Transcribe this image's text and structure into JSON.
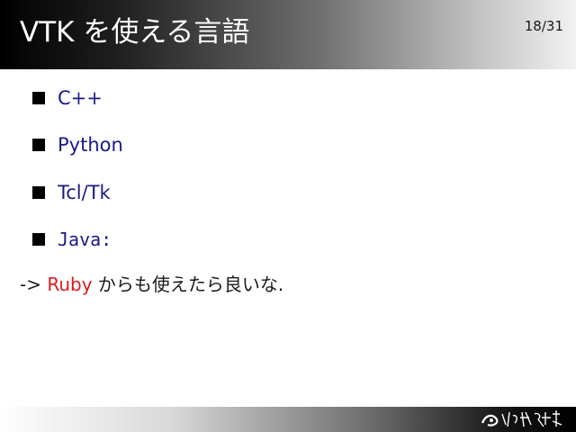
{
  "slide": {
    "title": "VTK を使える言語",
    "page_number": "18/31"
  },
  "bullets": [
    {
      "label": "C++"
    },
    {
      "label": "Python"
    },
    {
      "label": "Tcl/Tk"
    },
    {
      "label": "Java:"
    }
  ],
  "conclusion": {
    "prefix": "-> ",
    "highlight": "Ruby",
    "suffix": " からも使えたら良いな."
  },
  "colors": {
    "bullet_text": "#1a1a8a",
    "highlight": "#e0191c",
    "title_text": "#ffffff"
  },
  "footer": {
    "logo_icon": "calligraphy-logo-icon"
  }
}
